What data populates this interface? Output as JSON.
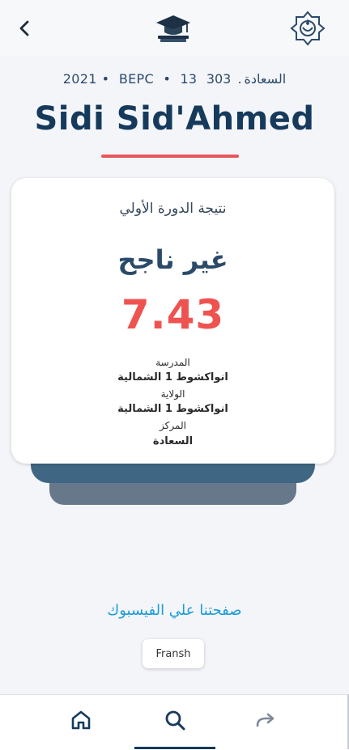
{
  "header": {
    "back_icon": "chevron-left-icon",
    "logo_icon": "graduation-cap-icon",
    "emblem_icon": "national-emblem-icon"
  },
  "candidate": {
    "meta": {
      "number": "303",
      "center": "السعادة",
      "room": "13",
      "exam": "BEPC",
      "year": "2021"
    },
    "name": "Sidi Sid'Ahmed"
  },
  "result_card": {
    "title": "نتيجة الدورة الأولي",
    "status": "غير ناجح",
    "score": "7.43",
    "school_label": "المدرسة",
    "school_value": "انواكشوط 1 الشمالية",
    "wilaya_label": "الولاية",
    "wilaya_value": "انواكشوط 1 الشمالية",
    "center_label": "المركز",
    "center_value": "السعادة"
  },
  "links": {
    "facebook": "صفحتنا علي الفيسبوك",
    "language_button": "Fransh"
  },
  "nav": {
    "items": [
      "home-icon",
      "search-icon",
      "share-icon"
    ],
    "active": "search-icon"
  },
  "colors": {
    "primary": "#163a5c",
    "accent_red": "#ef5350",
    "link_blue": "#1a9bd8"
  }
}
